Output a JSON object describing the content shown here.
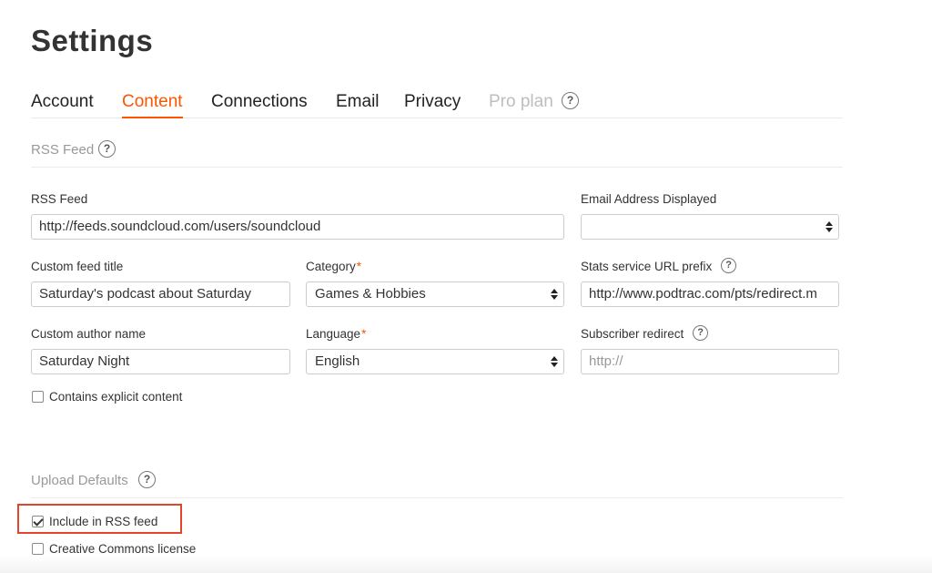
{
  "page": {
    "title": "Settings"
  },
  "tabs": [
    {
      "label": "Account",
      "active": false
    },
    {
      "label": "Content",
      "active": true
    },
    {
      "label": "Connections",
      "active": false
    },
    {
      "label": "Email",
      "active": false
    },
    {
      "label": "Privacy",
      "active": false
    },
    {
      "label": "Pro plan",
      "disabled": true
    }
  ],
  "help_glyph": "?",
  "rss_section": {
    "title": "RSS Feed",
    "rss_feed": {
      "label": "RSS Feed",
      "value": "http://feeds.soundcloud.com/users/soundcloud"
    },
    "email_displayed": {
      "label": "Email Address Displayed",
      "value": ""
    },
    "custom_feed_title": {
      "label": "Custom feed title",
      "value": "Saturday's podcast about Saturday"
    },
    "category": {
      "label": "Category",
      "required_mark": "*",
      "value": "Games & Hobbies"
    },
    "stats_prefix": {
      "label": "Stats service URL prefix",
      "value": "http://www.podtrac.com/pts/redirect.m"
    },
    "custom_author": {
      "label": "Custom author name",
      "value": "Saturday Night"
    },
    "language": {
      "label": "Language",
      "required_mark": "*",
      "value": "English"
    },
    "subscriber_redirect": {
      "label": "Subscriber redirect",
      "placeholder": "http://"
    },
    "explicit": {
      "label": "Contains explicit content",
      "checked": false
    }
  },
  "upload_section": {
    "title": "Upload Defaults",
    "include_rss": {
      "label": "Include in RSS feed",
      "checked": true
    },
    "creative_commons": {
      "label": "Creative Commons license",
      "checked": false
    }
  },
  "colors": {
    "accent": "#ff5500",
    "highlight": "#e2452c"
  }
}
